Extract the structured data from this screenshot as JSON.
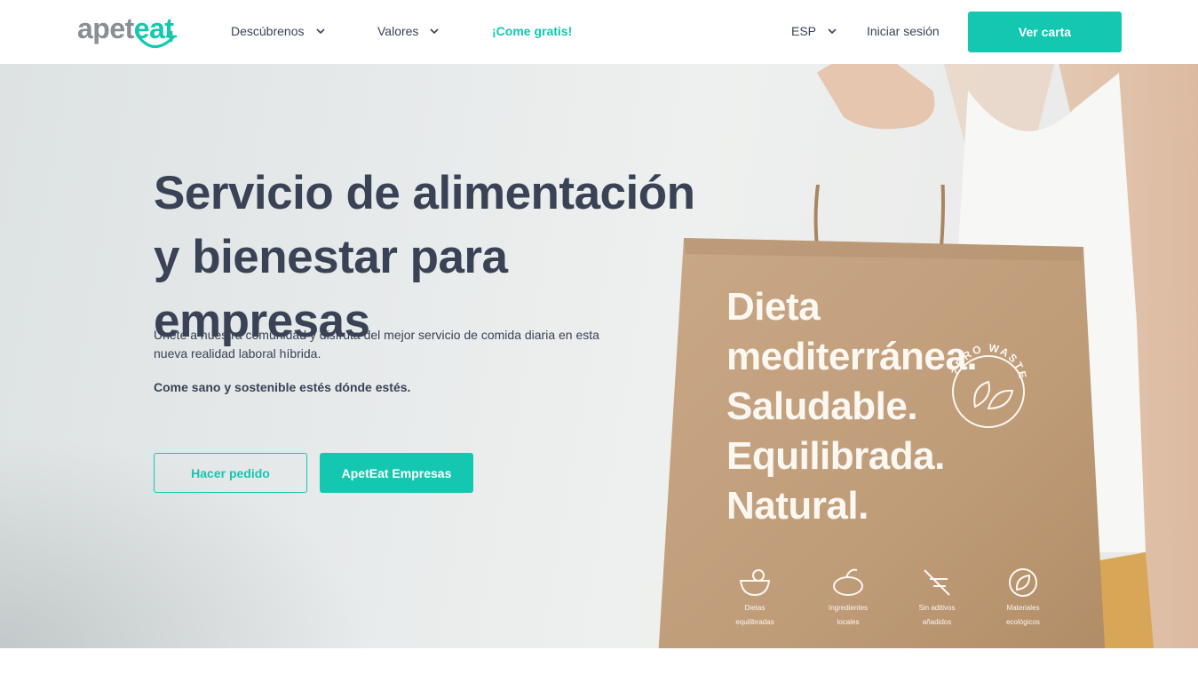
{
  "header": {
    "logo": {
      "part1": "apet",
      "part2": "eat"
    },
    "nav": [
      {
        "label": "Descúbrenos",
        "has_dropdown": true
      },
      {
        "label": "Valores",
        "has_dropdown": true
      },
      {
        "label": "¡Come gratis!",
        "has_dropdown": false
      }
    ],
    "language": "ESP",
    "login_label": "Iniciar sesión",
    "cta_label": "Ver carta"
  },
  "hero": {
    "title": "Servicio de alimentación y bienestar para empresas",
    "subtitle": "Únete a nuestra comunidad y disfruta del mejor servicio de comida diaria en esta nueva realidad laboral híbrida.",
    "tagline": "Come sano y sostenible estés dónde estés.",
    "primary_button": "Hacer pedido",
    "secondary_button": "ApetEat Empresas"
  },
  "bag": {
    "lines": [
      "Dieta",
      "mediterránea.",
      "Saludable.",
      "Equilibrada.",
      "Natural."
    ],
    "badge": "ZERO WASTE",
    "icons": [
      {
        "icon": "bowl-icon",
        "label1": "Dietas",
        "label2": "equilibradas"
      },
      {
        "icon": "vegetables-icon",
        "label1": "Ingredientes",
        "label2": "locales"
      },
      {
        "icon": "no-additives-icon",
        "label1": "Sin aditivos",
        "label2": "añadidos"
      },
      {
        "icon": "leaf-icon",
        "label1": "Materiales",
        "label2": "ecológicos"
      }
    ]
  },
  "colors": {
    "accent": "#14c7b0",
    "text": "#3a4256",
    "logo_gray": "#8a8d93",
    "bag": "#c2a07c"
  }
}
